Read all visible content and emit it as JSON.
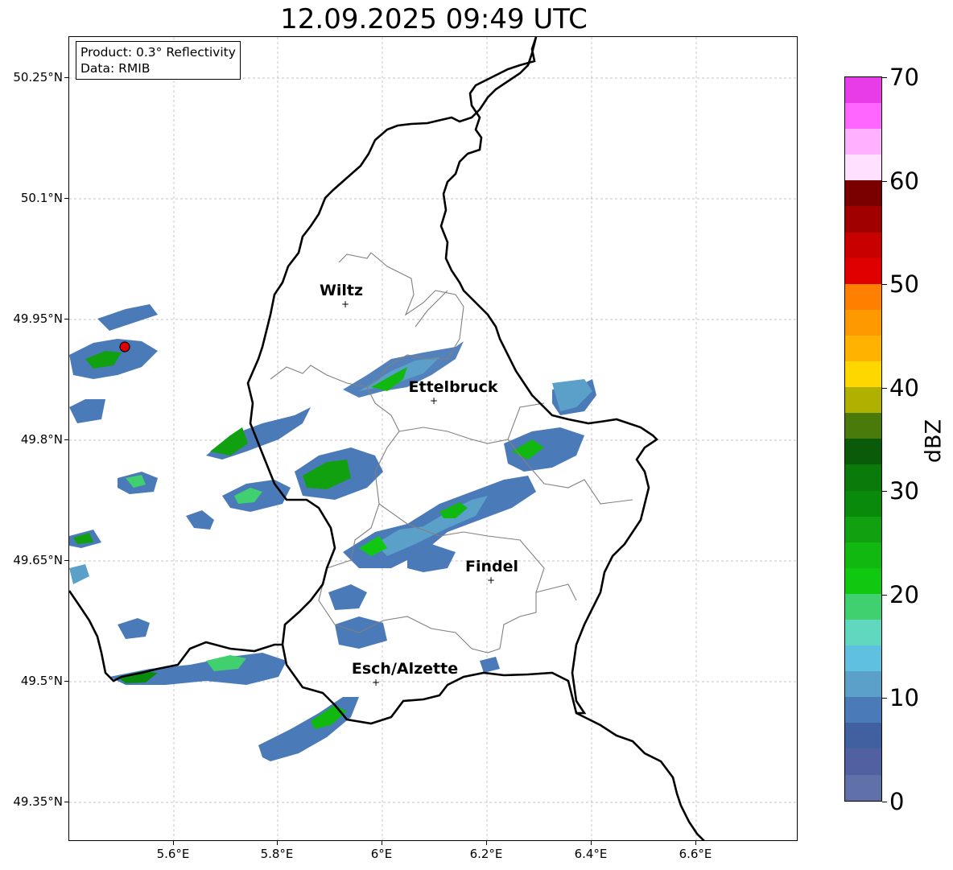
{
  "title": "12.09.2025 09:49 UTC",
  "info": {
    "product": "Product: 0.3° Reflectivity",
    "data": "Data: RMIB"
  },
  "lat_labels": [
    "50.25°N",
    "50.1°N",
    "49.95°N",
    "49.8°N",
    "49.65°N",
    "49.5°N",
    "49.35°N"
  ],
  "lon_labels": [
    "5.6°E",
    "5.8°E",
    "6°E",
    "6.2°E",
    "6.4°E",
    "6.6°E"
  ],
  "cities": [
    {
      "name": "Wiltz"
    },
    {
      "name": "Ettelbruck"
    },
    {
      "name": "Findel"
    },
    {
      "name": "Esch/Alzette"
    }
  ],
  "colorbar": {
    "label": "dBZ",
    "ticks": [
      "70",
      "60",
      "50",
      "40",
      "30",
      "20",
      "10",
      "0"
    ],
    "colors": [
      "#e83ce8",
      "#ff66ff",
      "#ffb0ff",
      "#ffe0ff",
      "#7a0000",
      "#a00000",
      "#c80000",
      "#e00000",
      "#ff7f00",
      "#ff9900",
      "#ffb300",
      "#ffd700",
      "#b0b000",
      "#4a7a0a",
      "#0a5a0a",
      "#0a7a0a",
      "#0a8a0a",
      "#10a010",
      "#10b810",
      "#10c810",
      "#40d070",
      "#60d8c0",
      "#60c0e0",
      "#5aa0c8",
      "#4a7ab8",
      "#4060a0",
      "#5060a0",
      "#6070a8"
    ]
  },
  "colors": {
    "border": "#000000",
    "canton_lines": "#808080",
    "grid": "#b0b0b0",
    "radar_site": "#e00000"
  }
}
